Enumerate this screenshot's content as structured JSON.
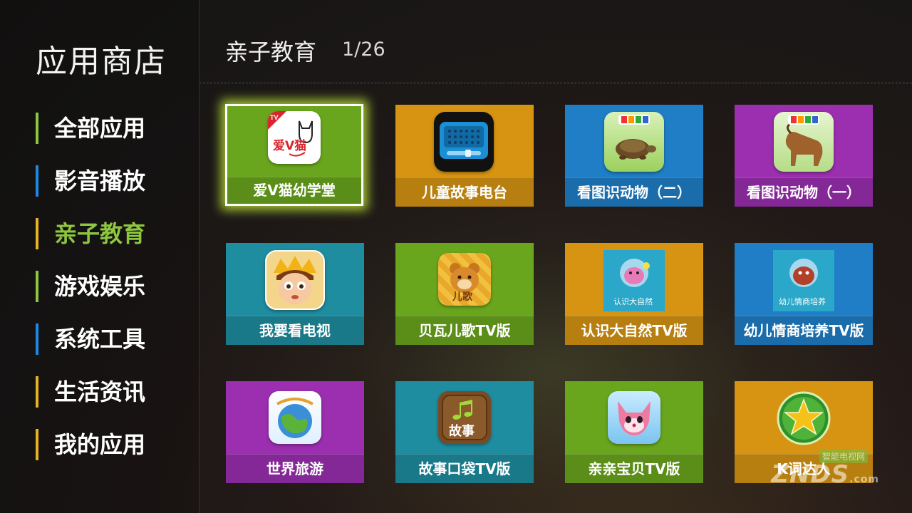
{
  "sidebar": {
    "title": "应用商店",
    "items": [
      {
        "label": "全部应用",
        "color": "#8ec63f",
        "active": false
      },
      {
        "label": "影音播放",
        "color": "#1e88e5",
        "active": false
      },
      {
        "label": "亲子教育",
        "color": "#e6b422",
        "active": true
      },
      {
        "label": "游戏娱乐",
        "color": "#8ec63f",
        "active": false
      },
      {
        "label": "系统工具",
        "color": "#1e88e5",
        "active": false
      },
      {
        "label": "生活资讯",
        "color": "#e6b422",
        "active": false
      },
      {
        "label": "我的应用",
        "color": "#e6b422",
        "active": false
      }
    ]
  },
  "header": {
    "category": "亲子教育",
    "page": "1/26"
  },
  "apps": [
    {
      "label": "爱V猫幼学堂",
      "color": "green",
      "icon": "cat-logo-icon",
      "selected": true
    },
    {
      "label": "儿童故事电台",
      "color": "orange",
      "icon": "radio-icon",
      "selected": false
    },
    {
      "label": "看图识动物（二）",
      "color": "blue",
      "icon": "tortoise-icon",
      "selected": false
    },
    {
      "label": "看图识动物（一）",
      "color": "purple",
      "icon": "goat-icon",
      "selected": false
    },
    {
      "label": "我要看电视",
      "color": "teal",
      "icon": "boy-cartoon-icon",
      "selected": false
    },
    {
      "label": "贝瓦儿歌TV版",
      "color": "green",
      "icon": "bear-icon",
      "selected": false
    },
    {
      "label": "认识大自然TV版",
      "color": "orange",
      "icon": "nature-icon",
      "selected": false
    },
    {
      "label": "幼儿情商培养TV版",
      "color": "blue",
      "icon": "eq-icon",
      "selected": false
    },
    {
      "label": "世界旅游",
      "color": "purple",
      "icon": "globe-icon",
      "selected": false
    },
    {
      "label": "故事口袋TV版",
      "color": "teal",
      "icon": "story-icon",
      "selected": false
    },
    {
      "label": "亲亲宝贝TV版",
      "color": "green",
      "icon": "fox-icon",
      "selected": false
    },
    {
      "label": "K词达人",
      "color": "orange",
      "icon": "star-icon",
      "selected": false
    }
  ],
  "icon_text": {
    "cat": "爱V猫",
    "tv": "TV",
    "nature": "认识大自然",
    "eq": "幼儿情商培养",
    "story": "故事",
    "bear": "儿歌"
  },
  "watermark": {
    "brand": "ZNDS",
    "domain": ".com",
    "sub": "智能电视网"
  }
}
